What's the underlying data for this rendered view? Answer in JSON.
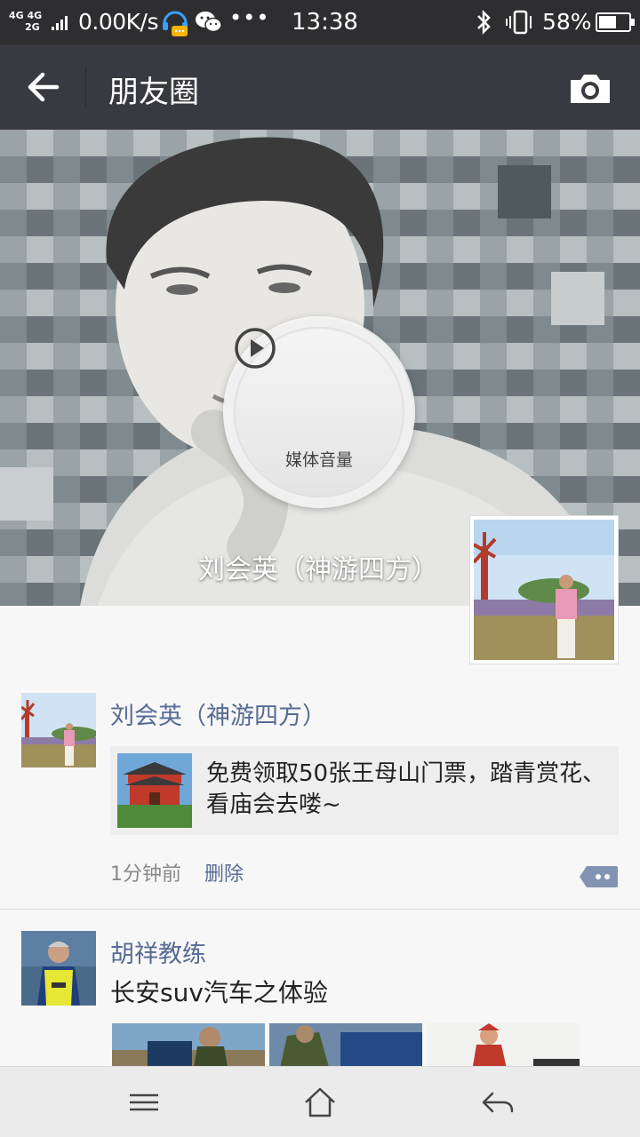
{
  "status_bar": {
    "network_label": "4G 4G 2G",
    "speed": "0.00K/s",
    "more": "•••",
    "time": "13:38",
    "battery_percent": "58%",
    "battery_level": 0.58
  },
  "header": {
    "title": "朋友圈",
    "back_icon": "arrow-left-icon",
    "camera_icon": "camera-icon"
  },
  "cover": {
    "user_name": "刘会英（神游四方）",
    "media_label": "媒体音量"
  },
  "feed": [
    {
      "name": "刘会英（神游四方）",
      "share_text": "免费领取50张王母山门票，踏青赏花、看庙会去喽~",
      "time": "1分钟前",
      "delete_label": "删除"
    },
    {
      "name": "胡祥教练",
      "text": "长安suv汽车之体验"
    }
  ],
  "colors": {
    "title_bar": "#393a3f",
    "status_bar": "#2e2e30",
    "link_blue": "#576b95",
    "background": "#f7f7f7"
  }
}
